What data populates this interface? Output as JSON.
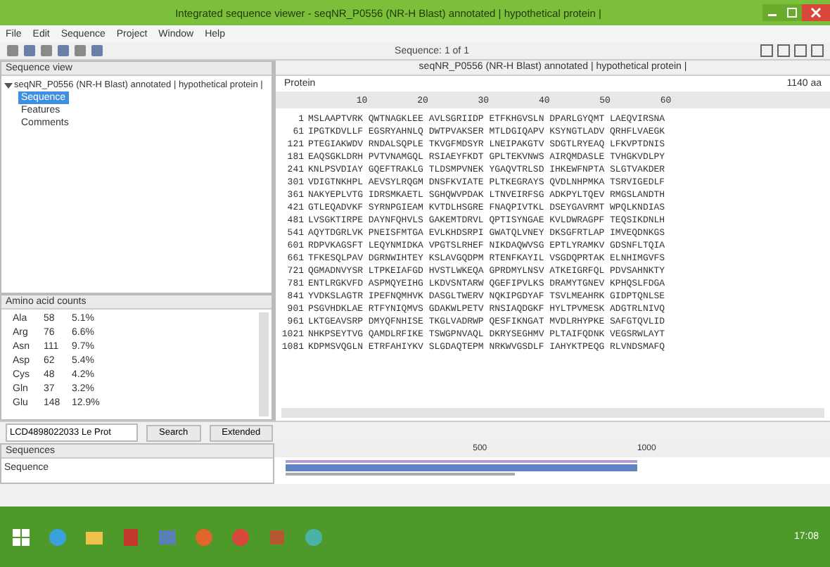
{
  "window": {
    "title": "Integrated sequence viewer - seqNR_P0556 (NR-H Blast) annotated | hypothetical protein |"
  },
  "menu": [
    "File",
    "Edit",
    "Sequence",
    "Project",
    "Window",
    "Help"
  ],
  "toolbar": {
    "center_label": "Sequence: 1 of 1"
  },
  "tree": {
    "header": "Sequence view",
    "root": {
      "label": "seqNR_P0556 (NR-H Blast) annotated | hypothetical protein |",
      "expanded": true,
      "children": [
        {
          "label": "Sequence",
          "selected": true
        },
        {
          "label": "Features",
          "selected": false
        },
        {
          "label": "Comments",
          "selected": false
        }
      ]
    }
  },
  "counts": {
    "header": "Amino acid counts",
    "rows": [
      {
        "residue": "Ala",
        "count": "58",
        "percent": "5.1%"
      },
      {
        "residue": "Arg",
        "count": "76",
        "percent": "6.6%"
      },
      {
        "residue": "Asn",
        "count": "111",
        "percent": "9.7%"
      },
      {
        "residue": "Asp",
        "count": "62",
        "percent": "5.4%"
      },
      {
        "residue": "Cys",
        "count": "48",
        "percent": "4.2%"
      },
      {
        "residue": "Gln",
        "count": "37",
        "percent": "3.2%"
      },
      {
        "residue": "Glu",
        "count": "148",
        "percent": "12.9%"
      }
    ]
  },
  "search": {
    "value": "LCD4898022033 Le Prot",
    "buttons": [
      "Search",
      "Extended"
    ]
  },
  "list_panel": {
    "header": "Sequences",
    "items": [
      "Sequence"
    ]
  },
  "viewer": {
    "title": "seqNR_P0556 (NR-H Blast) annotated | hypothetical protein |",
    "type_label": "Protein",
    "length": "1140 aa",
    "ruler": [
      "10",
      "20",
      "30",
      "40",
      "50",
      "60"
    ],
    "rows": [
      {
        "start": "1",
        "residues": "MSLAAPTVRK QWTNAGKLEE AVLSGRIIDP ETFKHGVSLN DPARLGYQMT LAEQVIRSNA"
      },
      {
        "start": "61",
        "residues": "IPGTKDVLLF EGSRYAHNLQ DWTPVAKSER MTLDGIQAPV KSYNGTLADV QRHFLVAEGK"
      },
      {
        "start": "121",
        "residues": "PTEGIAKWDV RNDALSQPLE TKVGFMDSYR LNEIPAKGTV SDGTLRYEAQ LFKVPTDNIS"
      },
      {
        "start": "181",
        "residues": "EAQSGKLDRH PVTVNAMGQL RSIAEYFKDT GPLTEKVNWS AIRQMDASLE TVHGKVDLPY"
      },
      {
        "start": "241",
        "residues": "KNLPSVDIAY GQEFTRAKLG TLDSMPVNEK YGAQVTRLSD IHKEWFNPTA SLGTVAKDER"
      },
      {
        "start": "301",
        "residues": "VDIGTNKHPL AEVSYLRQGM DNSFKVIATE PLTKEGRAYS QVDLNHPMKA TSRVIGEDLF"
      },
      {
        "start": "361",
        "residues": "NAKYEPLVTG IDRSMKAETL SGHQWVPDAK LTNVEIRFSG ADKPYLTQEV RMGSLANDTH"
      },
      {
        "start": "421",
        "residues": "GTLEQADVKF SYRNPGIEAM KVTDLHSGRE FNAQPIVTKL DSEYGAVRMT WPQLKNDIAS"
      },
      {
        "start": "481",
        "residues": "LVSGKTIRPE DAYNFQHVLS GAKEMTDRVL QPTISYNGAE KVLDWRAGPF TEQSIKDNLH"
      },
      {
        "start": "541",
        "residues": "AQYTDGRLVK PNEISFMTGA EVLKHDSRPI GWATQLVNEY DKSGFRTLAP IMVEQDNKGS"
      },
      {
        "start": "601",
        "residues": "RDPVKAGSFT LEQYNMIDKA VPGTSLRHEF NIKDAQWVSG EPTLYRAMKV GDSNFLTQIA"
      },
      {
        "start": "661",
        "residues": "TFKESQLPAV DGRNWIHTEY KSLAVGQDPM RTENFKAYIL VSGDQPRTAK ELNHIMGVFS"
      },
      {
        "start": "721",
        "residues": "QGMADNVYSR LTPKEIAFGD HVSTLWKEQA GPRDMYLNSV ATKEIGRFQL PDVSAHNKTY"
      },
      {
        "start": "781",
        "residues": "ENTLRGKVFD ASPMQYEIHG LKDVSNTARW QGEFIPVLKS DRAMYTGNEV KPHQSLFDGA"
      },
      {
        "start": "841",
        "residues": "YVDKSLAGTR IPEFNQMHVK DASGLTWERV NQKIPGDYAF TSVLMEAHRK GIDPTQNLSE"
      },
      {
        "start": "901",
        "residues": "PSGVHDKLAE RTFYNIQMVS GDAKWLPETV RNSIAQDGKF HYLTPVMESK ADGTRLNIVQ"
      },
      {
        "start": "961",
        "residues": "LKTGEAVSRP DMYQFNHISE TKGLVADRWP QESFIKNGAT MVDLRHYPKE SAFGTQVLID"
      },
      {
        "start": "1021",
        "residues": "NHKPSEYTVG QAMDLRFIKE TSWGPNVAQL DKRYSEGHMV PLTAIFQDNK VEGSRWLAYT"
      },
      {
        "start": "1081",
        "residues": "KDPMSVQGLN ETRFAHIYKV SLGDAQTEPM NRKWVGSDLF IAHYKTPEQG RLVNDSMAFQ"
      }
    ]
  },
  "overview": {
    "ticks": [
      "500",
      "1000"
    ]
  },
  "taskbar": {
    "clock": "17:08"
  }
}
